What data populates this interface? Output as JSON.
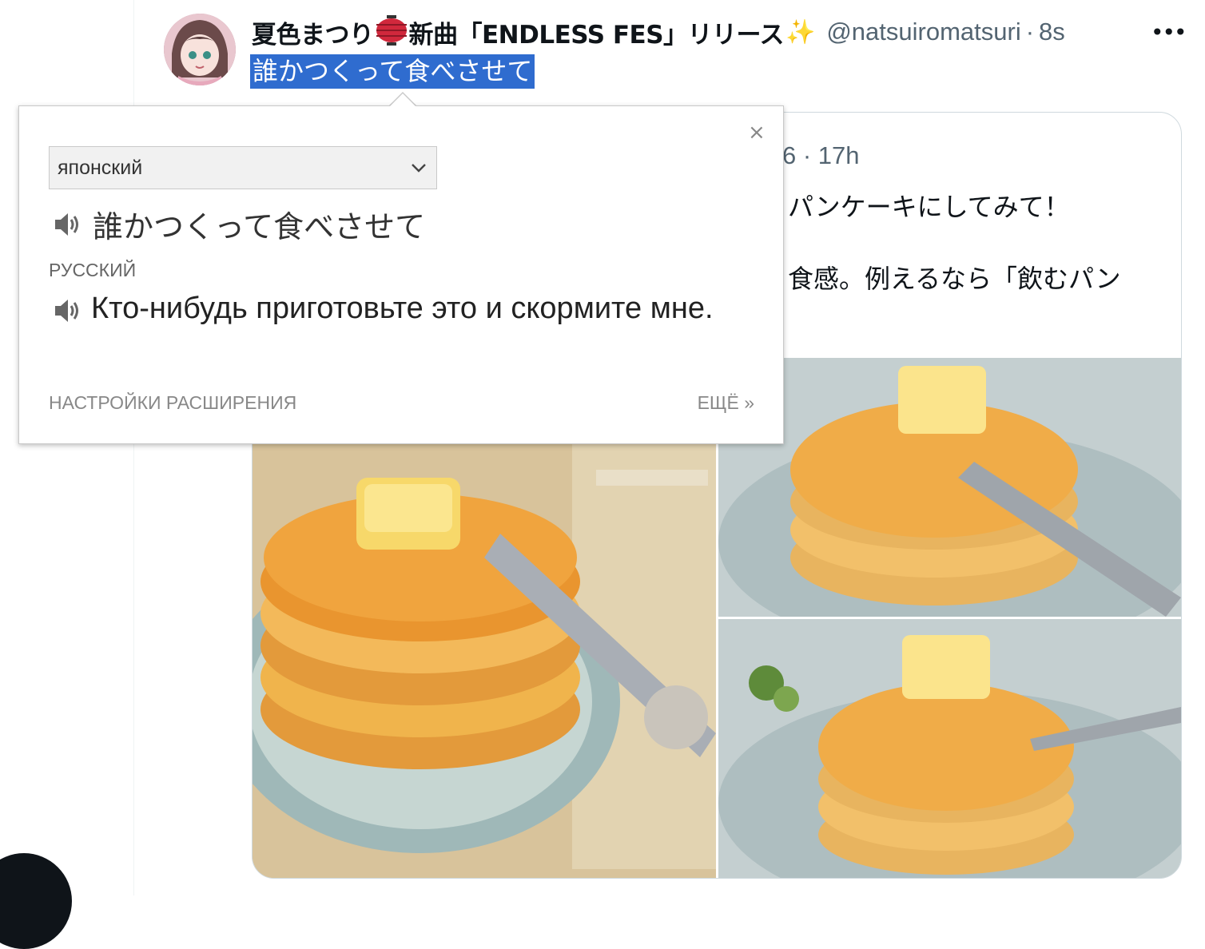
{
  "tweet": {
    "display_name": "夏色まつり",
    "display_name_suffix": "新曲「ENDLESS FES」リリース",
    "lantern_icon": "red-lantern-icon",
    "sparkle_icon": "sparkle-icon",
    "sparkle_glyph": "✨",
    "handle": "@natsuiromatsuri",
    "separator": "·",
    "time": "8s",
    "more_glyph": "•••",
    "text": "誰かつくって食べさせて"
  },
  "quoted": {
    "time": "6 · 17h",
    "line1": "パンケーキにしてみて！",
    "line2": "食感。例えるなら「飲むパン"
  },
  "popup": {
    "close_glyph": "×",
    "source_language": "японский",
    "source_text": "誰かつくって食べさせて",
    "target_language": "РУССКИЙ",
    "target_text": "Кто-нибудь приготовьте это и скормите мне.",
    "settings_label": "НАСТРОЙКИ РАСШИРЕНИЯ",
    "more_label": "ЕЩЁ »"
  },
  "colors": {
    "selection": "#2f6ccf",
    "text_primary": "#0f1419",
    "text_secondary": "#536471",
    "border": "#cfd9de"
  }
}
